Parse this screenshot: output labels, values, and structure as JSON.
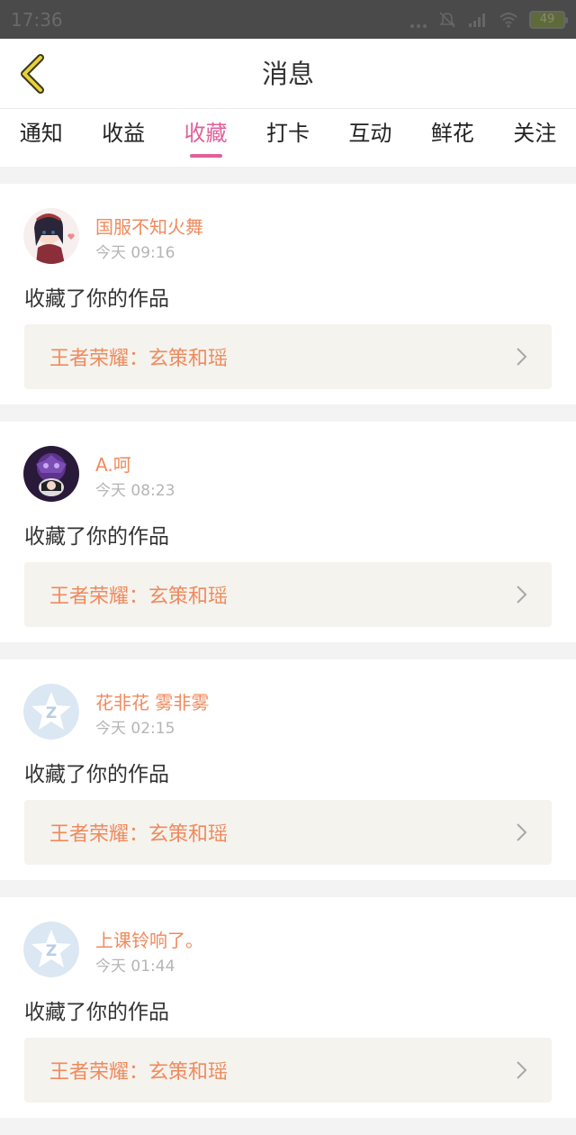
{
  "status_bar": {
    "time": "17:36",
    "battery": "49"
  },
  "header": {
    "title": "消息"
  },
  "tabs": [
    {
      "label": "通知",
      "active": false
    },
    {
      "label": "收益",
      "active": false
    },
    {
      "label": "收藏",
      "active": true
    },
    {
      "label": "打卡",
      "active": false
    },
    {
      "label": "互动",
      "active": false
    },
    {
      "label": "鲜花",
      "active": false
    },
    {
      "label": "关注",
      "active": false
    }
  ],
  "colors": {
    "accent": "#e0609a",
    "username": "#f08a5d",
    "work_title": "#f08a5d"
  },
  "messages": [
    {
      "username": "国服不知火舞",
      "time": "今天 09:16",
      "action": "收藏了你的作品",
      "work_title": "王者荣耀：玄策和瑶",
      "avatar": "anime-girl-avatar"
    },
    {
      "username": "A.呵",
      "time": "今天 08:23",
      "action": "收藏了你的作品",
      "work_title": "王者荣耀：玄策和瑶",
      "avatar": "purple-dark-avatar"
    },
    {
      "username": "花非花 雾非雾",
      "time": "今天 02:15",
      "action": "收藏了你的作品",
      "work_title": "王者荣耀：玄策和瑶",
      "avatar": "default-qzone-avatar"
    },
    {
      "username": "上课铃响了。",
      "time": "今天 01:44",
      "action": "收藏了你的作品",
      "work_title": "王者荣耀：玄策和瑶",
      "avatar": "default-qzone-avatar"
    }
  ]
}
